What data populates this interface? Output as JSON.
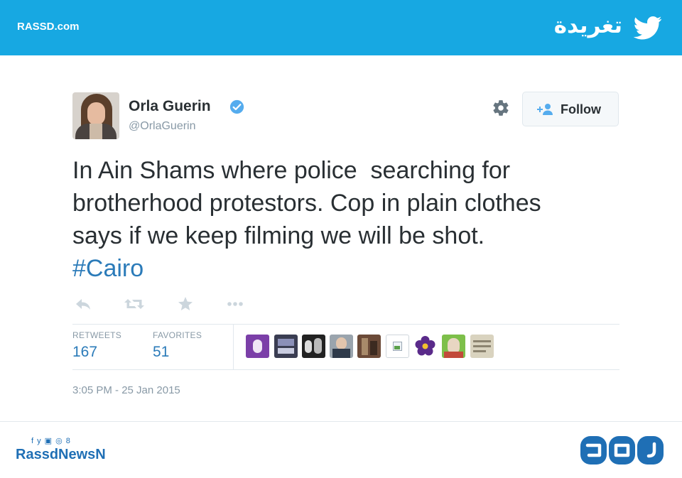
{
  "banner": {
    "site": "RASSD.com",
    "title": "تغريدة",
    "bird_icon": "twitter-bird-icon",
    "bg_color": "#17a8e2"
  },
  "tweet": {
    "author_name": "Orla Guerin",
    "handle": "@OrlaGuerin",
    "verified": true,
    "text_lines": [
      "In Ain Shams where police  searching for",
      "brotherhood protestors. Cop in plain clothes",
      "says if we keep filming we will be shot."
    ],
    "hashtag": "#Cairo",
    "follow_label": "Follow",
    "actions": [
      "reply-icon",
      "retweet-icon",
      "favorite-icon",
      "more-icon"
    ],
    "stats": {
      "retweets_label": "RETWEETS",
      "retweets_value": "167",
      "favorites_label": "FAVORITES",
      "favorites_value": "51"
    },
    "favoriter_avatars": 10,
    "timestamp": "3:05 PM - 25 Jan 2015",
    "accent_color": "#2b7bb9"
  },
  "footer": {
    "social_icons": "f y ▣ ◎ 8",
    "brand": "RassdNewsN",
    "logo": "rassd-logo-icon"
  }
}
